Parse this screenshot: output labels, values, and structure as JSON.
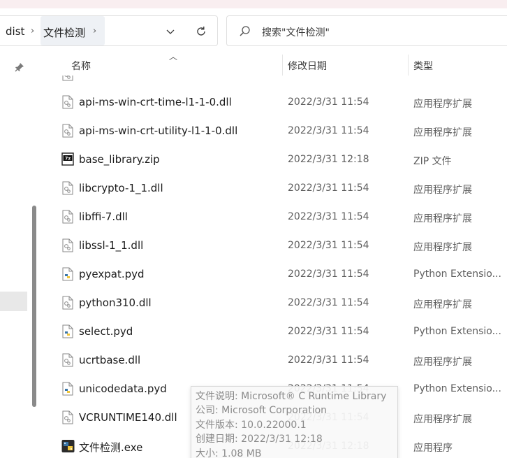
{
  "breadcrumb": {
    "items": [
      "dist",
      "文件检测"
    ],
    "separator": "›"
  },
  "address_controls": {
    "dropdown_icon": "chevron-down-icon",
    "refresh_icon": "refresh-icon"
  },
  "search": {
    "placeholder": "搜索\"文件检测\""
  },
  "columns": {
    "name": "名称",
    "date": "修改日期",
    "type": "类型"
  },
  "files": [
    {
      "name": "api-ms-win-crt-time-l1-1-0.dll",
      "date": "2022/3/31 11:54",
      "type": "应用程序扩展",
      "icon": "dll-file-icon"
    },
    {
      "name": "api-ms-win-crt-utility-l1-1-0.dll",
      "date": "2022/3/31 11:54",
      "type": "应用程序扩展",
      "icon": "dll-file-icon"
    },
    {
      "name": "base_library.zip",
      "date": "2022/3/31 12:18",
      "type": "ZIP 文件",
      "icon": "zip-7z-icon"
    },
    {
      "name": "libcrypto-1_1.dll",
      "date": "2022/3/31 11:54",
      "type": "应用程序扩展",
      "icon": "dll-file-icon"
    },
    {
      "name": "libffi-7.dll",
      "date": "2022/3/31 11:54",
      "type": "应用程序扩展",
      "icon": "dll-file-icon"
    },
    {
      "name": "libssl-1_1.dll",
      "date": "2022/3/31 11:54",
      "type": "应用程序扩展",
      "icon": "dll-file-icon"
    },
    {
      "name": "pyexpat.pyd",
      "date": "2022/3/31 11:54",
      "type": "Python Extensio...",
      "icon": "python-file-icon"
    },
    {
      "name": "python310.dll",
      "date": "2022/3/31 11:54",
      "type": "应用程序扩展",
      "icon": "dll-file-icon"
    },
    {
      "name": "select.pyd",
      "date": "2022/3/31 11:54",
      "type": "Python Extensio...",
      "icon": "python-file-icon"
    },
    {
      "name": "ucrtbase.dll",
      "date": "2022/3/31 11:54",
      "type": "应用程序扩展",
      "icon": "dll-file-icon"
    },
    {
      "name": "unicodedata.pyd",
      "date": "2022/3/31 11:54",
      "type": "Python Extensio...",
      "icon": "python-file-icon"
    },
    {
      "name": "VCRUNTIME140.dll",
      "date": "2022/3/31 11:54",
      "type": "应用程序扩展",
      "icon": "dll-file-icon"
    },
    {
      "name": "文件检测.exe",
      "date": "2022/3/31 12:18",
      "type": "应用程序",
      "icon": "python-exe-icon"
    }
  ],
  "tooltip": {
    "lines": [
      "文件说明: Microsoft® C Runtime Library",
      "公司: Microsoft Corporation",
      "文件版本: 10.0.22000.1",
      "创建日期: 2022/3/31 12:18",
      "大小: 1.08 MB"
    ]
  },
  "colors": {
    "python_blue": "#3a76a8",
    "python_yellow": "#f2c73c",
    "selection": "#e8e8e8"
  }
}
